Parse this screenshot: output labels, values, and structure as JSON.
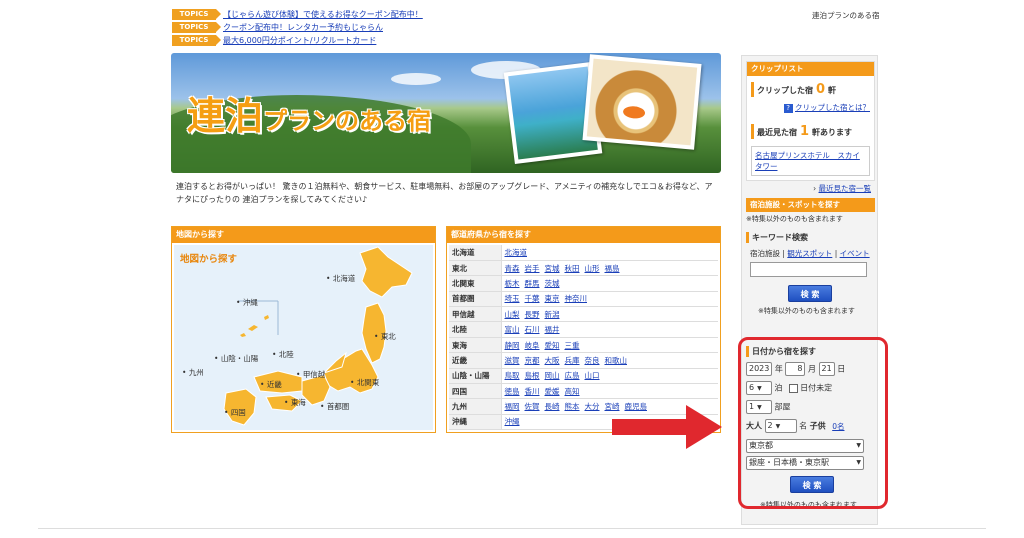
{
  "topics": [
    {
      "badge": "TOPICS",
      "text": "【じゃらん遊び体験】で使えるお得なクーポン配布中！"
    },
    {
      "badge": "TOPICS",
      "text": "クーポン配布中！レンタカー予約もじゃらん"
    },
    {
      "badge": "TOPICS",
      "text": "最大6,000円分ポイント/リクルートカード"
    }
  ],
  "site_tag": "連泊プランのある宿",
  "banner": {
    "title_big": "連泊",
    "title_small": "プランのある宿"
  },
  "description": "連泊するとお得がいっぱい！ 驚きの１泊無料や、朝食サービス、駐車場無料、お部屋のアップグレード、アメニティの補充なしでエコ＆お得など、アナタにぴったりの 連泊プランを探してみてください♪",
  "map": {
    "header": "地図から探す",
    "title": "地図から探す",
    "regions": [
      "北海道",
      "沖縄",
      "東北",
      "山陰・山陽",
      "北陸",
      "九州",
      "甲信越",
      "近畿",
      "北関東",
      "東海",
      "首都圏",
      "四国"
    ]
  },
  "prefectures": {
    "header": "都道府県から宿を探す",
    "rows": [
      {
        "region": "北海道",
        "prefs": [
          "北海道"
        ]
      },
      {
        "region": "東北",
        "prefs": [
          "青森",
          "岩手",
          "宮城",
          "秋田",
          "山形",
          "福島"
        ]
      },
      {
        "region": "北関東",
        "prefs": [
          "栃木",
          "群馬",
          "茨城"
        ]
      },
      {
        "region": "首都圏",
        "prefs": [
          "埼玉",
          "千葉",
          "東京",
          "神奈川"
        ]
      },
      {
        "region": "甲信越",
        "prefs": [
          "山梨",
          "長野",
          "新潟"
        ]
      },
      {
        "region": "北陸",
        "prefs": [
          "富山",
          "石川",
          "福井"
        ]
      },
      {
        "region": "東海",
        "prefs": [
          "静岡",
          "岐阜",
          "愛知",
          "三重"
        ]
      },
      {
        "region": "近畿",
        "prefs": [
          "滋賀",
          "京都",
          "大阪",
          "兵庫",
          "奈良",
          "和歌山"
        ]
      },
      {
        "region": "山陰・山陽",
        "prefs": [
          "鳥取",
          "島根",
          "岡山",
          "広島",
          "山口"
        ]
      },
      {
        "region": "四国",
        "prefs": [
          "徳島",
          "香川",
          "愛媛",
          "高知"
        ]
      },
      {
        "region": "九州",
        "prefs": [
          "福岡",
          "佐賀",
          "長崎",
          "熊本",
          "大分",
          "宮崎",
          "鹿児島"
        ]
      },
      {
        "region": "沖縄",
        "prefs": [
          "沖縄"
        ]
      }
    ]
  },
  "sidebar": {
    "clip": {
      "header": "クリップリスト",
      "label": "クリップした宿",
      "count": "0",
      "unit": "軒",
      "help_link": "クリップした宿とは？"
    },
    "recent": {
      "label": "最近見た宿",
      "count": "1",
      "unit": "軒あります",
      "hotel": "名古屋プリンスホテル　スカイタワー",
      "list_link": "最近見た宿一覧"
    },
    "spot": {
      "header": "宿泊施設・スポットを探す",
      "note_top": "※特集以外のものも含まれます",
      "keyword_label": "キーワード検索",
      "tab_lodging": "宿泊施設",
      "tab_sep": "|",
      "tab_spot": "観光スポット",
      "tab_event": "イベント",
      "input_value": "",
      "search_label": "検 索",
      "note_bottom": "※特集以外のものも含まれます"
    },
    "date": {
      "title": "日付から宿を探す",
      "year": "2023",
      "year_unit": "年",
      "month": "8",
      "month_unit": "月",
      "day": "21",
      "day_unit": "日",
      "nights": "6",
      "nights_unit": "泊",
      "undecided": "日付未定",
      "rooms": "1",
      "rooms_unit": "部屋",
      "adult_label": "大人",
      "adults": "2",
      "adults_unit": "名",
      "child_label": "子供",
      "children_link": "0名",
      "prefecture": "東京都",
      "area": "銀座・日本橋・東京駅",
      "search_label": "検 索",
      "note": "※特集以外のものも含まれます"
    }
  },
  "colors": {
    "accent": "#f49a1a",
    "link": "#1a3fb8",
    "highlight": "#e0282e"
  }
}
